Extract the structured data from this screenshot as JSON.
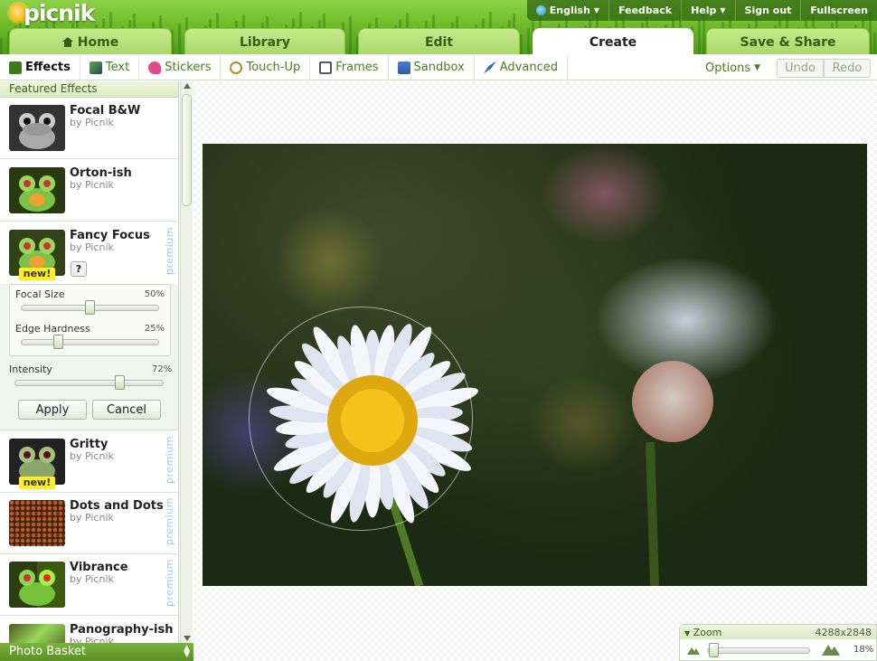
{
  "app": {
    "name": "picnik"
  },
  "topnav": {
    "language": "English",
    "feedback": "Feedback",
    "help": "Help",
    "signout": "Sign out",
    "fullscreen": "Fullscreen"
  },
  "tabs": [
    "Home",
    "Library",
    "Edit",
    "Create",
    "Save & Share"
  ],
  "subnav": {
    "items": [
      "Effects",
      "Text",
      "Stickers",
      "Touch-Up",
      "Frames",
      "Sandbox",
      "Advanced"
    ],
    "options": "Options",
    "undo": "Undo",
    "redo": "Redo"
  },
  "panel": {
    "title": "Featured Effects",
    "premium_label": "premium",
    "new_label": "new!",
    "help_label": "?",
    "effects": [
      {
        "name": "Focal B&W",
        "by": "by Picnik"
      },
      {
        "name": "Orton-ish",
        "by": "by Picnik"
      },
      {
        "name": "Fancy Focus",
        "by": "by Picnik"
      },
      {
        "name": "Gritty",
        "by": "by Picnik"
      },
      {
        "name": "Dots and Dots",
        "by": "by Picnik"
      },
      {
        "name": "Vibrance",
        "by": "by Picnik"
      },
      {
        "name": "Panography-ish",
        "by": "by Picnik"
      }
    ],
    "controls": {
      "focal_size_label": "Focal Size",
      "focal_size": "50%",
      "focal_size_frac": 0.5,
      "edge_hardness_label": "Edge Hardness",
      "edge_hardness": "25%",
      "edge_hardness_frac": 0.25,
      "intensity_label": "Intensity",
      "intensity": "72%",
      "intensity_frac": 0.72,
      "apply": "Apply",
      "cancel": "Cancel"
    }
  },
  "basket": "Photo Basket",
  "zoom": {
    "label": "Zoom",
    "dims": "4288x2848",
    "percent": "18%",
    "frac": 0.02
  },
  "colors": {
    "accent_green": "#4b7c1d",
    "premium_blue": "#a9c6d9",
    "new_yellow": "#ffee22"
  }
}
